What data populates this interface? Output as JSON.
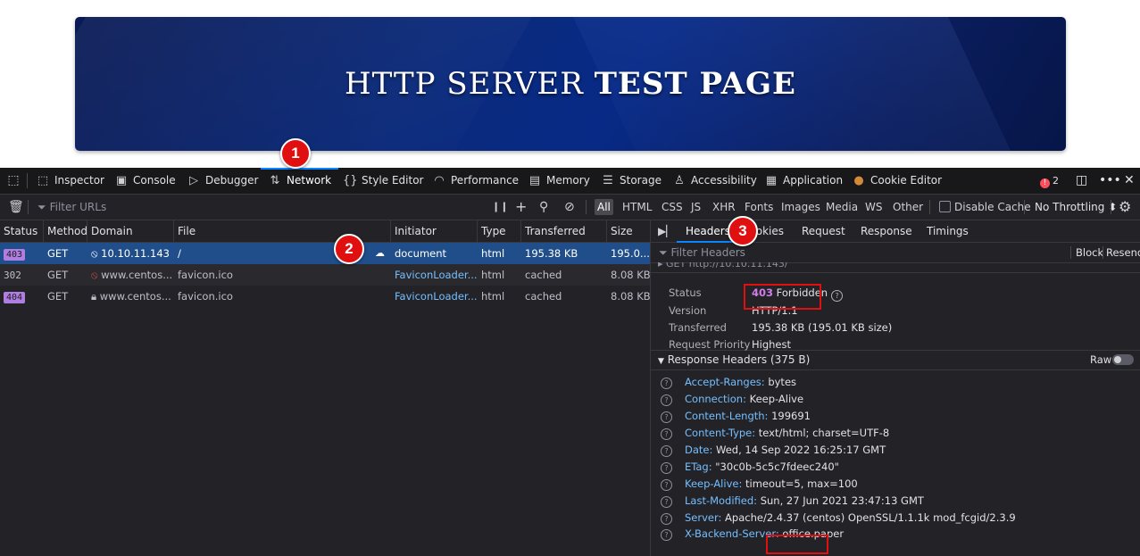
{
  "banner": {
    "title_regular": "HTTP SERVER",
    "title_bold": "TEST PAGE"
  },
  "devtools": {
    "tabs": [
      {
        "label": "Inspector",
        "icon": "inspector-icon"
      },
      {
        "label": "Console",
        "icon": "console-icon"
      },
      {
        "label": "Debugger",
        "icon": "debugger-icon"
      },
      {
        "label": "Network",
        "icon": "network-icon",
        "active": true
      },
      {
        "label": "Style Editor",
        "icon": "style-editor-icon"
      },
      {
        "label": "Performance",
        "icon": "performance-icon"
      },
      {
        "label": "Memory",
        "icon": "memory-icon"
      },
      {
        "label": "Storage",
        "icon": "storage-icon"
      },
      {
        "label": "Accessibility",
        "icon": "accessibility-icon"
      },
      {
        "label": "Application",
        "icon": "application-icon"
      },
      {
        "label": "Cookie Editor",
        "icon": "cookie-icon"
      }
    ],
    "error_count": "2",
    "toolbar": {
      "filter_placeholder": "Filter URLs",
      "types": [
        "All",
        "HTML",
        "CSS",
        "JS",
        "XHR",
        "Fonts",
        "Images",
        "Media",
        "WS",
        "Other"
      ],
      "active_type": "All",
      "disable_cache": "Disable Cache",
      "throttling": "No Throttling ⬍"
    },
    "columns": [
      "Status",
      "Method",
      "Domain",
      "File",
      "Initiator",
      "Type",
      "Transferred",
      "Size"
    ],
    "requests": [
      {
        "status": "403",
        "method": "GET",
        "domain": "10.10.11.143",
        "file": "/",
        "initiator": "document",
        "type": "html",
        "transferred": "195.38 KB",
        "size": "195.0..."
      },
      {
        "status": "302",
        "method": "GET",
        "domain": "www.centos...",
        "file": "favicon.ico",
        "initiator": "FaviconLoader....",
        "type": "html",
        "transferred": "cached",
        "size": "8.08 KB"
      },
      {
        "status": "404",
        "method": "GET",
        "domain": "www.centos...",
        "file": "favicon.ico",
        "initiator": "FaviconLoader....",
        "type": "html",
        "transferred": "cached",
        "size": "8.08 KB"
      }
    ],
    "details": {
      "tabs": [
        "Headers",
        "Cookies",
        "Request",
        "Response",
        "Timings"
      ],
      "active_tab": "Headers",
      "filter_placeholder": "Filter Headers",
      "block": "Block",
      "resend": "Resend",
      "request_line": "▸ GET http://10.10.11.143/",
      "summary": {
        "status_label": "Status",
        "status_code": "403",
        "status_text": "Forbidden",
        "version_label": "Version",
        "version": "HTTP/1.1",
        "transferred_label": "Transferred",
        "transferred": "195.38 KB (195.01 KB size)",
        "priority_label": "Request Priority",
        "priority": "Highest"
      },
      "response_headers_title": "Response Headers (375 B)",
      "raw_label": "Raw",
      "response_headers": [
        {
          "name": "Accept-Ranges:",
          "value": "bytes"
        },
        {
          "name": "Connection:",
          "value": "Keep-Alive"
        },
        {
          "name": "Content-Length:",
          "value": "199691"
        },
        {
          "name": "Content-Type:",
          "value": "text/html; charset=UTF-8"
        },
        {
          "name": "Date:",
          "value": "Wed, 14 Sep 2022 16:25:17 GMT"
        },
        {
          "name": "ETag:",
          "value": "\"30c0b-5c5c7fdeec240\""
        },
        {
          "name": "Keep-Alive:",
          "value": "timeout=5, max=100"
        },
        {
          "name": "Last-Modified:",
          "value": "Sun, 27 Jun 2021 23:47:13 GMT"
        },
        {
          "name": "Server:",
          "value": "Apache/2.4.37 (centos) OpenSSL/1.1.1k mod_fcgid/2.3.9"
        },
        {
          "name": "X-Backend-Server:",
          "value": "office.paper"
        }
      ]
    }
  },
  "annotations": [
    "1",
    "2",
    "3"
  ],
  "colors": {
    "accent": "#0a84ff",
    "annotation_red": "#e01010",
    "selected_row": "#204e8a",
    "status_403": "#b07ee0"
  }
}
